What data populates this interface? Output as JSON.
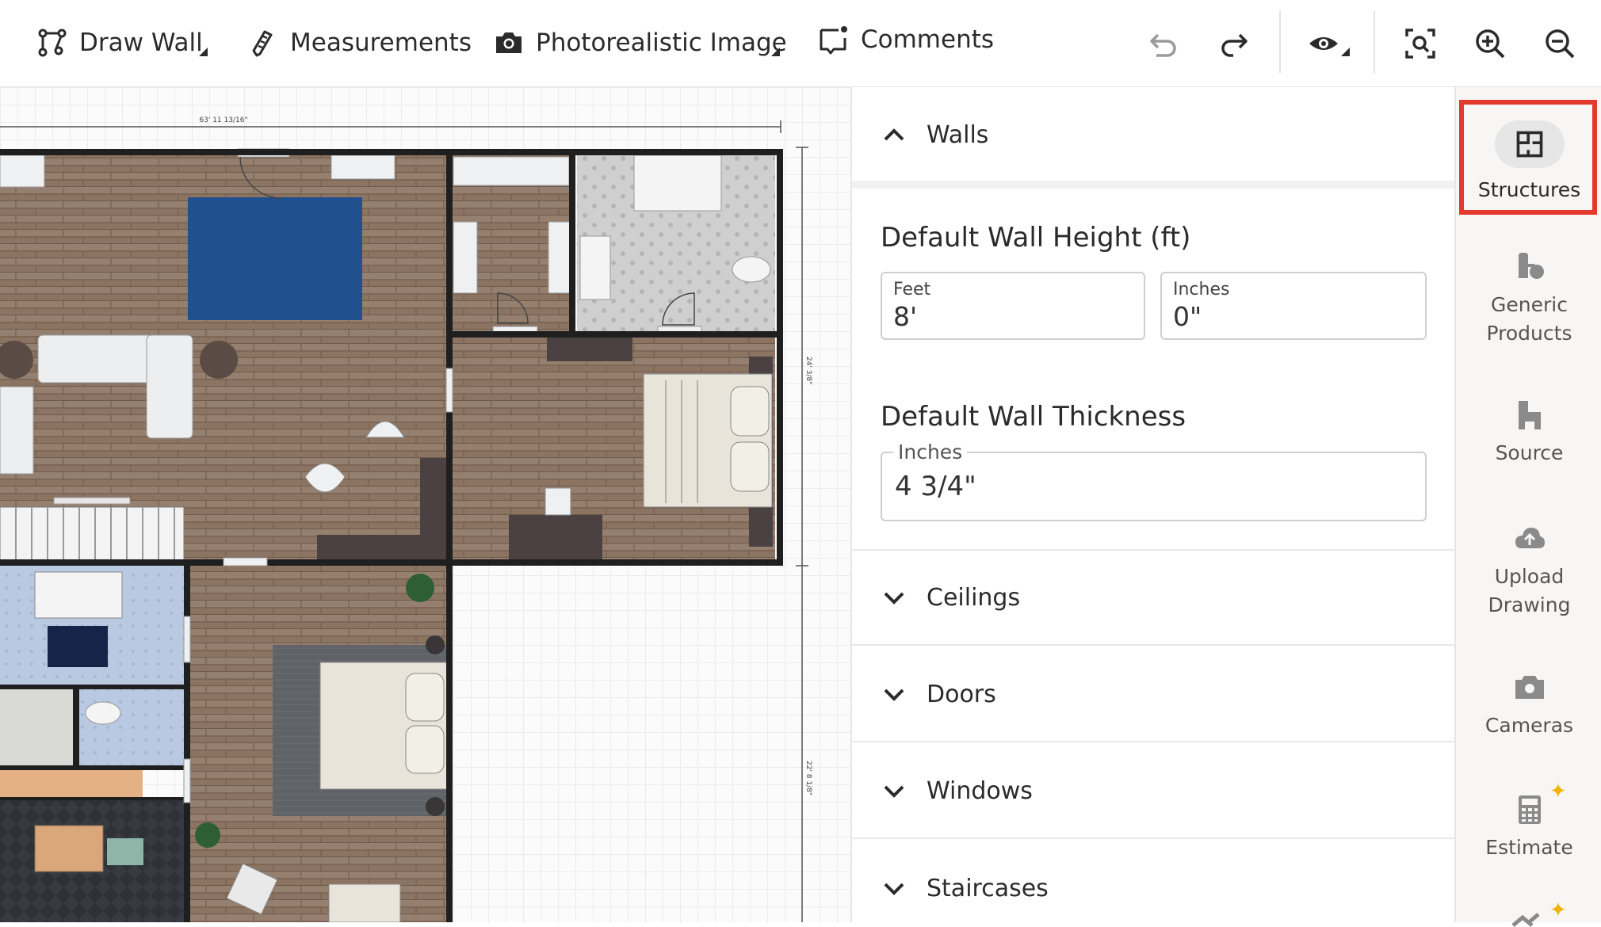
{
  "toolbar": {
    "draw_wall": "Draw Wall",
    "measurements": "Measurements",
    "photo": "Photorealistic Image",
    "comments": "Comments",
    "icons": [
      "draw-wall-icon",
      "pencil-icon",
      "camera-icon",
      "comment-icon",
      "undo-icon",
      "redo-icon",
      "eye-icon",
      "focus-icon",
      "zoom-in-icon",
      "zoom-out-icon"
    ]
  },
  "canvas": {
    "dim_top": "63' 11 13/16\"",
    "dim_right_1": "24' 3/8\"",
    "dim_right_2": "22' 8 1/8\""
  },
  "panel": {
    "walls": "Walls",
    "wall_height_title": "Default Wall Height (ft)",
    "feet_label": "Feet",
    "feet_value": "8'",
    "inches_label": "Inches",
    "inches_value": "0\"",
    "wall_thickness_title": "Default Wall Thickness",
    "thickness_label": "Inches",
    "thickness_value": "4 3/4\"",
    "sections": [
      "Ceilings",
      "Doors",
      "Windows",
      "Staircases"
    ]
  },
  "sidebar": {
    "structures": "Structures",
    "generic_1": "Generic",
    "generic_2": "Products",
    "source": "Source",
    "upload_1": "Upload",
    "upload_2": "Drawing",
    "cameras": "Cameras",
    "estimate": "Estimate"
  },
  "colors": {
    "highlight": "#e23a2d",
    "wood": "#8c7462",
    "rug_blue": "#21508f",
    "bath_blue": "#b9c9e2",
    "wall": "#1f1f1f"
  }
}
